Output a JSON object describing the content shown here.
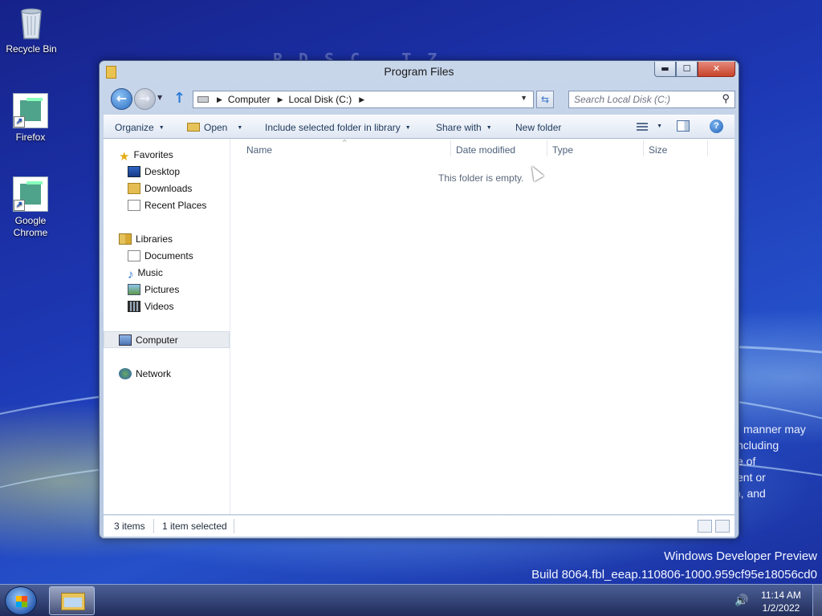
{
  "desktop": {
    "icons": [
      {
        "label": "Recycle Bin",
        "icon": "recycle-bin-icon"
      },
      {
        "label": "Firefox",
        "icon": "firefox-icon"
      },
      {
        "label": "Google Chrome",
        "icon": "chrome-icon"
      }
    ],
    "behind_text": [
      "manner may",
      "ncluding",
      "e of",
      "ent or",
      "), and"
    ],
    "bg_letters": "RDSC  TZ",
    "watermark": {
      "line1": "Windows Developer Preview",
      "line2": "Build 8064.fbl_eeap.110806-1000.959cf95e18056cd0"
    }
  },
  "window": {
    "title": "Program Files",
    "buttons": {
      "minimize": "▬",
      "maximize": "☐",
      "close": "✕"
    },
    "address": {
      "crumbs": [
        "Computer",
        "Local Disk (C:)"
      ]
    },
    "search": {
      "placeholder": "Search Local Disk (C:)"
    },
    "toolbar": {
      "organize": "Organize",
      "open": "Open",
      "include": "Include selected folder in library",
      "share": "Share with",
      "new_folder": "New folder"
    },
    "navpane": {
      "favorites": "Favorites",
      "desktop": "Desktop",
      "downloads": "Downloads",
      "recent": "Recent Places",
      "libraries": "Libraries",
      "documents": "Documents",
      "music": "Music",
      "pictures": "Pictures",
      "videos": "Videos",
      "computer": "Computer",
      "network": "Network"
    },
    "columns": {
      "name": "Name",
      "date": "Date modified",
      "type": "Type",
      "size": "Size"
    },
    "empty_message": "This folder is empty.",
    "status": {
      "items": "3 items",
      "selected": "1 item selected"
    }
  },
  "taskbar": {
    "time": "11:14 AM",
    "date": "1/2/2022"
  },
  "colors": {
    "accent": "#2c6fc4",
    "desktop": "#1d37b3",
    "taskbar": "#202c5a"
  }
}
